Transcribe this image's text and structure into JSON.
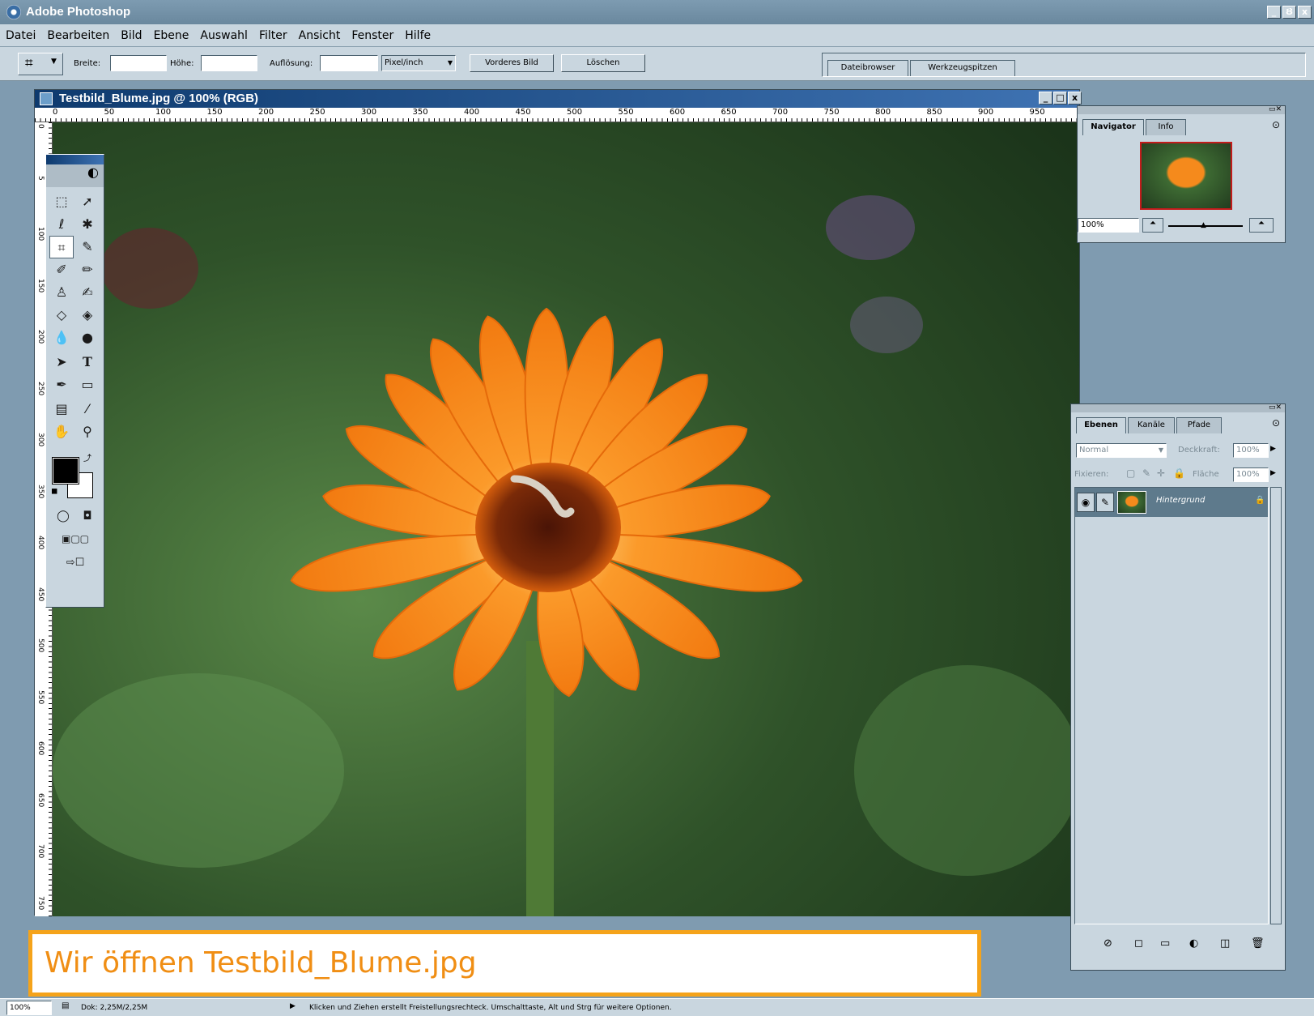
{
  "app": {
    "title": "Adobe Photoshop"
  },
  "window_controls": {
    "minimize": "_",
    "restore": "Ȣ",
    "close": "x"
  },
  "menu": [
    "Datei",
    "Bearbeiten",
    "Bild",
    "Ebene",
    "Auswahl",
    "Filter",
    "Ansicht",
    "Fenster",
    "Hilfe"
  ],
  "options": {
    "width_label": "Breite:",
    "height_label": "Höhe:",
    "resolution_label": "Auflösung:",
    "unit_select": "Pixel/inch",
    "front_image_button": "Vorderes Bild",
    "clear_button": "Löschen"
  },
  "palette_well": {
    "tabs": [
      "Dateibrowser",
      "Werkzeugspitzen"
    ]
  },
  "document": {
    "title": "Testbild_Blume.jpg @ 100% (RGB)",
    "ruler_h": [
      "0",
      "50",
      "100",
      "150",
      "200",
      "250",
      "300",
      "350",
      "400",
      "450",
      "500",
      "550",
      "600",
      "650",
      "700",
      "750",
      "800",
      "850",
      "900",
      "950"
    ],
    "ruler_v": [
      "0",
      "5",
      "100",
      "150",
      "200",
      "250",
      "300",
      "350",
      "400",
      "450",
      "500",
      "550",
      "600",
      "650",
      "700",
      "750"
    ]
  },
  "navigator": {
    "tabs": [
      "Navigator",
      "Info"
    ],
    "zoom": "100%"
  },
  "layers": {
    "tabs": [
      "Ebenen",
      "Kanäle",
      "Pfade"
    ],
    "blend_mode": "Normal",
    "opacity_label": "Deckkraft:",
    "opacity": "100%",
    "lock_label": "Fixieren:",
    "fill_label": "Fläche",
    "fill": "100%",
    "layer_name": "Hintergrund"
  },
  "status": {
    "zoom": "100%",
    "doc_size": "Dok: 2,25M/2,25M",
    "hint": "Klicken und Ziehen erstellt Freistellungsrechteck. Umschalttaste, Alt und Strg für weitere Optionen."
  },
  "caption": "Wir öffnen Testbild_Blume.jpg",
  "colors": {
    "accent_orange": "#f5a31a",
    "ui_gray": "#c9d6df",
    "title_blue": "#0e3a6e"
  }
}
